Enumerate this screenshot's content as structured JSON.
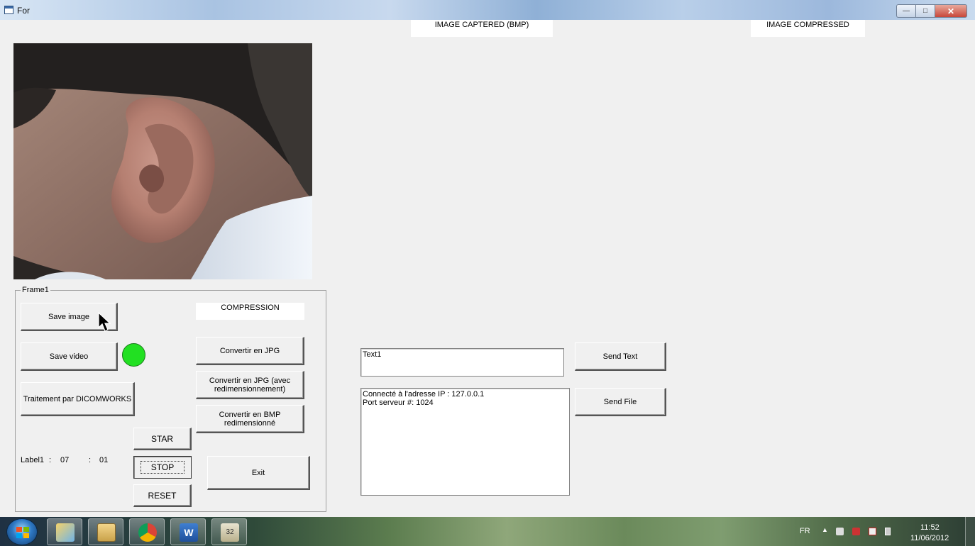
{
  "window": {
    "title": "For"
  },
  "labels": {
    "image_captured": "IMAGE CAPTERED (BMP)",
    "image_compressed": "IMAGE COMPRESSED",
    "compression": "COMPRESSION",
    "frame_title": "Frame1"
  },
  "buttons": {
    "save_image": "Save image",
    "save_video": "Save video",
    "dicomworks": "Traitement par DICOMWORKS",
    "jpg": "Convertir en JPG",
    "jpg_resize": "Convertir en JPG (avec redimensionnement)",
    "bmp_resize": "Convertir en BMP redimensionné",
    "start": "STAR",
    "stop": "STOP",
    "reset": "RESET",
    "exit": "Exit",
    "send_text": "Send Text",
    "send_file": "Send File"
  },
  "timer": {
    "label": "Label1",
    "sep1": ":",
    "minutes": "07",
    "sep2": ":",
    "seconds": "01"
  },
  "text_input": {
    "value": "Text1"
  },
  "log": {
    "line1": "Connecté à l'adresse IP : 127.0.0.1",
    "line2": "Port serveur #: 1024"
  },
  "status": {
    "led_color": "#22e022"
  },
  "taskbar": {
    "lang": "FR",
    "time": "11:52",
    "date": "11/06/2012",
    "items": [
      "windows-explorer-icon",
      "file-manager-icon",
      "chrome-icon",
      "word-icon",
      "app-32-icon"
    ]
  }
}
